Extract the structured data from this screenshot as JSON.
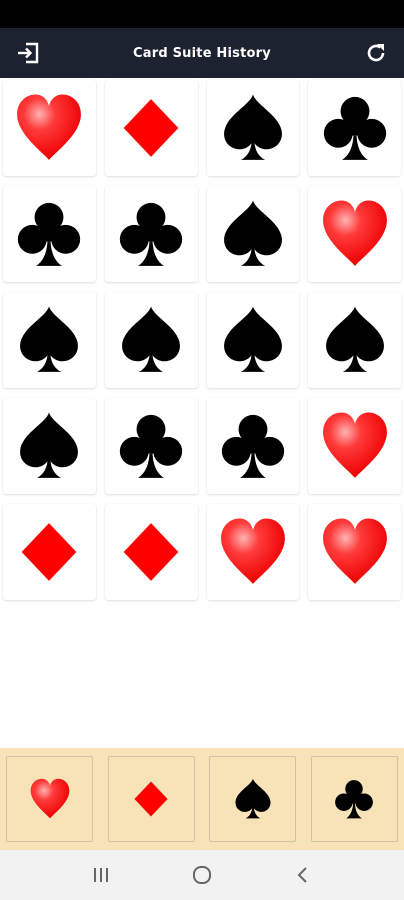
{
  "app_bar": {
    "title": "Card Suite History",
    "left_icon": "exit-icon",
    "right_icon": "refresh-icon"
  },
  "history": [
    "heart",
    "diamond",
    "spade",
    "club",
    "club",
    "club",
    "spade",
    "heart",
    "spade",
    "spade",
    "spade",
    "spade",
    "spade",
    "club",
    "club",
    "heart",
    "diamond",
    "diamond",
    "heart",
    "heart"
  ],
  "suit_buttons": [
    "heart",
    "diamond",
    "spade",
    "club"
  ],
  "colors": {
    "app_bar": "#1c2230",
    "red": "#ff0000",
    "black": "#000000",
    "panel": "#f8e3b8"
  },
  "nav": {
    "recents_icon": "recents-icon",
    "home_icon": "home-icon",
    "back_icon": "back-icon"
  }
}
